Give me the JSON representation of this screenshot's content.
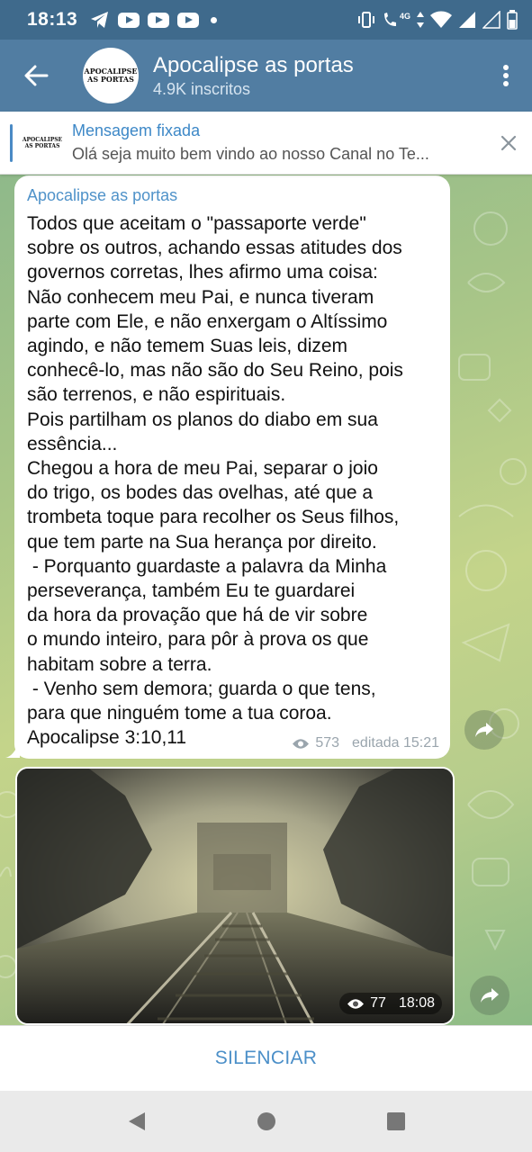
{
  "status_bar": {
    "time": "18:13",
    "network_label": "4G",
    "icons": [
      "telegram-icon",
      "youtube-icon",
      "youtube-icon",
      "youtube-icon",
      "dot-icon",
      "vibrate-icon",
      "wifi-call-icon",
      "data-arrows-icon",
      "wifi-icon",
      "signal-icon",
      "signal-icon",
      "battery-icon"
    ]
  },
  "header": {
    "back_icon": "arrow-left-icon",
    "avatar_text_line1": "APOCALIPSE",
    "avatar_text_line2": "AS PORTAS",
    "title": "Apocalipse as portas",
    "subtitle": "4.9K inscritos",
    "menu_icon": "more-vertical-icon"
  },
  "pinned": {
    "thumb_line1": "APOCALIPSE",
    "thumb_line2": "AS PORTAS",
    "title": "Mensagem fixada",
    "message": "Olá seja muito bem vindo ao nosso Canal no Te...",
    "close_icon": "close-icon"
  },
  "messages": [
    {
      "author": "Apocalipse as portas",
      "text": "Todos que aceitam o \"passaporte verde\"\nsobre os outros, achando essas atitudes dos\ngovernos corretas, lhes afirmo uma coisa:\nNão conhecem meu Pai, e nunca tiveram\nparte com Ele, e não enxergam o Altíssimo\nagindo, e não temem Suas leis, dizem\nconhecê-lo, mas não são do Seu Reino, pois\nsão terrenos, e não espirituais.\nPois partilham os planos do diabo em sua\nessência...\nChegou a hora de meu Pai, separar o joio\ndo trigo, os bodes das ovelhas, até que a\ntrombeta toque para recolher os Seus filhos,\nque tem parte na Sua herança por direito.\n - Porquanto guardaste a palavra da Minha\nperseverança, também Eu te guardarei\nda hora da provação que há de vir sobre\no mundo inteiro, para pôr à prova os que\nhabitam sobre a terra.\n - Venho sem demora; guarda o que tens,\npara que ninguém tome a tua coroa.\nApocalipse 3:10,11",
      "views": "573",
      "time": "editada 15:21"
    },
    {
      "type": "photo",
      "views": "77",
      "time": "18:08"
    }
  ],
  "bottom": {
    "mute_label": "SILENCIAR"
  },
  "colors": {
    "statusbar": "#3f6a8c",
    "header": "#517da2",
    "accent": "#4b8fc8"
  }
}
